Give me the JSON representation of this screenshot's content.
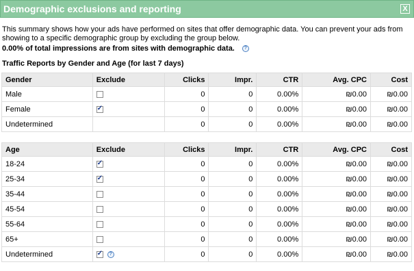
{
  "dialog": {
    "title": "Demographic exclusions and reporting",
    "close_label": "X"
  },
  "description": "This summary shows how your ads have performed on sites that offer demographic data. You can prevent your ads from showing to a specific demographic group by excluding the group below.",
  "summary_text": "0.00% of total impressions are from sites with demographic data.",
  "help_icon_label": "?",
  "section_title": "Traffic Reports by Gender and Age (for last 7 days)",
  "gender_table": {
    "headers": {
      "name": "Gender",
      "exclude": "Exclude",
      "clicks": "Clicks",
      "impr": "Impr.",
      "ctr": "CTR",
      "cpc": "Avg. CPC",
      "cost": "Cost"
    },
    "rows": [
      {
        "name": "Male",
        "exclude": false,
        "clicks": "0",
        "impr": "0",
        "ctr": "0.00%",
        "cpc": "₪0.00",
        "cost": "₪0.00"
      },
      {
        "name": "Female",
        "exclude": true,
        "clicks": "0",
        "impr": "0",
        "ctr": "0.00%",
        "cpc": "₪0.00",
        "cost": "₪0.00"
      },
      {
        "name": "Undetermined",
        "exclude": null,
        "clicks": "0",
        "impr": "0",
        "ctr": "0.00%",
        "cpc": "₪0.00",
        "cost": "₪0.00"
      }
    ]
  },
  "age_table": {
    "headers": {
      "name": "Age",
      "exclude": "Exclude",
      "clicks": "Clicks",
      "impr": "Impr.",
      "ctr": "CTR",
      "cpc": "Avg. CPC",
      "cost": "Cost"
    },
    "rows": [
      {
        "name": "18-24",
        "exclude": true,
        "clicks": "0",
        "impr": "0",
        "ctr": "0.00%",
        "cpc": "₪0.00",
        "cost": "₪0.00"
      },
      {
        "name": "25-34",
        "exclude": true,
        "clicks": "0",
        "impr": "0",
        "ctr": "0.00%",
        "cpc": "₪0.00",
        "cost": "₪0.00"
      },
      {
        "name": "35-44",
        "exclude": false,
        "clicks": "0",
        "impr": "0",
        "ctr": "0.00%",
        "cpc": "₪0.00",
        "cost": "₪0.00"
      },
      {
        "name": "45-54",
        "exclude": false,
        "clicks": "0",
        "impr": "0",
        "ctr": "0.00%",
        "cpc": "₪0.00",
        "cost": "₪0.00"
      },
      {
        "name": "55-64",
        "exclude": false,
        "clicks": "0",
        "impr": "0",
        "ctr": "0.00%",
        "cpc": "₪0.00",
        "cost": "₪0.00"
      },
      {
        "name": "65+",
        "exclude": false,
        "clicks": "0",
        "impr": "0",
        "ctr": "0.00%",
        "cpc": "₪0.00",
        "cost": "₪0.00"
      },
      {
        "name": "Undetermined",
        "exclude": true,
        "help": true,
        "clicks": "0",
        "impr": "0",
        "ctr": "0.00%",
        "cpc": "₪0.00",
        "cost": "₪0.00"
      }
    ]
  },
  "colors": {
    "titlebar_bg": "#8cc9a0",
    "header_bg": "#eaeaea",
    "help_icon": "#4a7fc1"
  }
}
